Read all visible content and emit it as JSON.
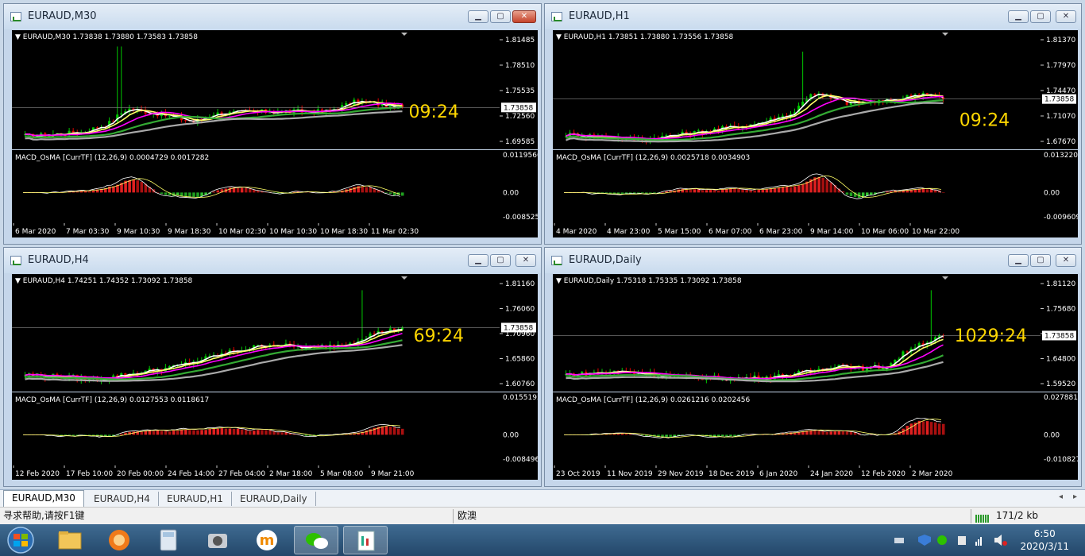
{
  "windows": [
    {
      "title": "EURAUD,M30",
      "header": "EURAUD,M30  1.73838 1.73880 1.73583 1.73858",
      "current_price": "1.73858",
      "price_ticks": [
        "1.81485",
        "1.78510",
        "1.75535",
        "1.72560",
        "1.69585"
      ],
      "countdown": "09:24",
      "indicator_header": "MACD_OsMA [CurrTF] (12,26,9) 0.0004729 0.0017282",
      "ind_ticks": [
        "0.0119566",
        "0.00",
        "-0.008525"
      ],
      "time_labels": [
        "6 Mar 2020",
        "7 Mar 03:30",
        "9 Mar 10:30",
        "9 Mar 18:30",
        "10 Mar 02:30",
        "10 Mar 10:30",
        "10 Mar 18:30",
        "11 Mar 02:30"
      ],
      "close_active": true
    },
    {
      "title": "EURAUD,H1",
      "header": "EURAUD,H1  1.73851 1.73880 1.73556 1.73858",
      "current_price": "1.73858",
      "price_ticks": [
        "1.81370",
        "1.77970",
        "1.74470",
        "1.71070",
        "1.67670"
      ],
      "countdown": "09:24",
      "indicator_header": "MACD_OsMA [CurrTF] (12,26,9) 0.0025718 0.0034903",
      "ind_ticks": [
        "0.0132201",
        "0.00",
        "-0.009609"
      ],
      "time_labels": [
        "4 Mar 2020",
        "4 Mar 23:00",
        "5 Mar 15:00",
        "6 Mar 07:00",
        "6 Mar 23:00",
        "9 Mar 14:00",
        "10 Mar 06:00",
        "10 Mar 22:00"
      ],
      "close_active": false
    },
    {
      "title": "EURAUD,H4",
      "header": "EURAUD,H4  1.74251 1.74352 1.73092 1.73858",
      "current_price": "1.73858",
      "price_ticks": [
        "1.81160",
        "1.76060",
        "1.70960",
        "1.65860",
        "1.60760"
      ],
      "countdown": "69:24",
      "indicator_header": "MACD_OsMA [CurrTF] (12,26,9) 0.0127553 0.0118617",
      "ind_ticks": [
        "0.0155195",
        "0.00",
        "-0.008496"
      ],
      "time_labels": [
        "12 Feb 2020",
        "17 Feb 10:00",
        "20 Feb 00:00",
        "24 Feb 14:00",
        "27 Feb 04:00",
        "2 Mar 18:00",
        "5 Mar 08:00",
        "9 Mar 21:00"
      ],
      "close_active": false
    },
    {
      "title": "EURAUD,Daily",
      "header": "EURAUD,Daily  1.75318 1.75335 1.73092 1.73858",
      "current_price": "1.73858",
      "price_ticks": [
        "1.81120",
        "1.75680",
        "1.70240",
        "1.64800",
        "1.59520"
      ],
      "countdown": "1029:24",
      "indicator_header": "MACD_OsMA [CurrTF] (12,26,9) 0.0261216 0.0202456",
      "ind_ticks": [
        "0.0278811",
        "0.00",
        "-0.0108274"
      ],
      "time_labels": [
        "23 Oct 2019",
        "11 Nov 2019",
        "29 Nov 2019",
        "18 Dec 2019",
        "6 Jan 2020",
        "24 Jan 2020",
        "12 Feb 2020",
        "2 Mar 2020"
      ],
      "close_active": false
    }
  ],
  "tabs": [
    "EURAUD,M30",
    "EURAUD,H4",
    "EURAUD,H1",
    "EURAUD,Daily"
  ],
  "status": {
    "help": "寻求帮助,请按F1键",
    "profile": "欧澳",
    "traffic": "171/2 kb"
  },
  "clock": {
    "time": "6:50",
    "date": "2020/3/11"
  },
  "colors": {
    "up_candle": "#00c800",
    "down_candle": "#e00000",
    "ma_fast": "#ffffff",
    "ma_yellow": "#ffff66",
    "ma_magenta": "#ff00ff",
    "ma_green": "#33aa33",
    "ma_gray": "#aaaaaa",
    "countdown": "#ffd700"
  }
}
